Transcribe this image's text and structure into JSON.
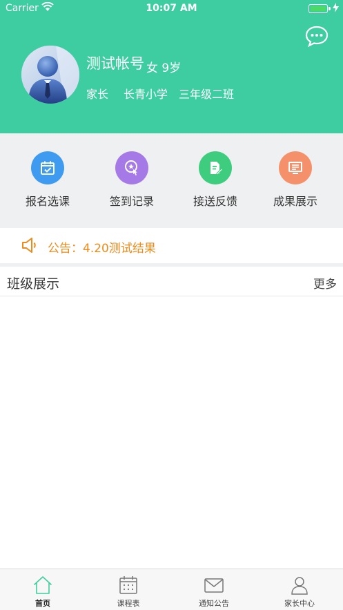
{
  "status_bar": {
    "carrier": "Carrier",
    "time": "10:07 AM"
  },
  "profile": {
    "name": "测试帐号",
    "gender_age": "女 9岁",
    "role": "家长",
    "school": "长青小学",
    "class": "三年级二班"
  },
  "menu": {
    "items": [
      {
        "label": "报名选课",
        "icon": "calendar-check-icon",
        "color": "#3f9bf0"
      },
      {
        "label": "签到记录",
        "icon": "touch-star-icon",
        "color": "#a57ae6"
      },
      {
        "label": "接送反馈",
        "icon": "document-edit-icon",
        "color": "#3ecd7e"
      },
      {
        "label": "成果展示",
        "icon": "display-board-icon",
        "color": "#f5916a"
      }
    ]
  },
  "notice": {
    "text": "公告：4.20测试结果",
    "color": "#ec8b1b"
  },
  "section": {
    "title": "班级展示",
    "more": "更多"
  },
  "tabbar": {
    "tabs": [
      {
        "label": "首页",
        "icon": "home-icon",
        "active": true
      },
      {
        "label": "课程表",
        "icon": "calendar-grid-icon",
        "active": false
      },
      {
        "label": "通知公告",
        "icon": "mail-icon",
        "active": false
      },
      {
        "label": "家长中心",
        "icon": "person-icon",
        "active": false
      }
    ]
  },
  "colors": {
    "header": "#3ecda0",
    "page_bg": "#eff0f2",
    "accent": "#3ecda0"
  }
}
